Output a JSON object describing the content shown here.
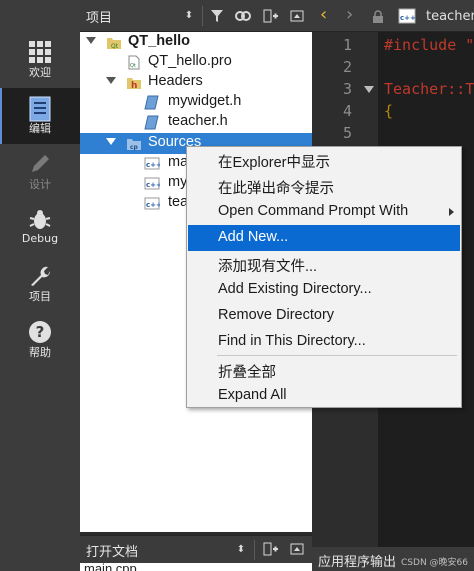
{
  "modes": [
    {
      "id": "welcome",
      "label": "欢迎",
      "icon": "grid-icon"
    },
    {
      "id": "edit",
      "label": "编辑",
      "icon": "document-icon"
    },
    {
      "id": "design",
      "label": "设计",
      "icon": "pencil-icon"
    },
    {
      "id": "debug",
      "label": "Debug",
      "icon": "bug-icon"
    },
    {
      "id": "projects",
      "label": "项目",
      "icon": "wrench-icon"
    },
    {
      "id": "help",
      "label": "帮助",
      "icon": "question-icon"
    }
  ],
  "project_panel": {
    "title": "项目",
    "tree": [
      {
        "label": "QT_hello",
        "icon": "project-folder-icon"
      },
      {
        "label": "QT_hello.pro",
        "icon": "pro-file-icon"
      },
      {
        "label": "Headers",
        "icon": "headers-folder-icon"
      },
      {
        "label": "mywidget.h",
        "icon": "header-file-icon"
      },
      {
        "label": "teacher.h",
        "icon": "header-file-icon"
      },
      {
        "label": "Sources",
        "icon": "sources-folder-icon",
        "selected": true
      },
      {
        "label": "ma",
        "icon": "cpp-file-icon"
      },
      {
        "label": "my",
        "icon": "cpp-file-icon"
      },
      {
        "label": "tea",
        "icon": "cpp-file-icon"
      }
    ]
  },
  "open_docs": {
    "title": "打开文档",
    "items": [
      "main.cpp"
    ]
  },
  "editor": {
    "tab_label": "teacher",
    "line_numbers": [
      "1",
      "2",
      "3",
      "4",
      "5"
    ],
    "code_lines": [
      "#include \"",
      "",
      "Teacher::T",
      "{",
      ""
    ]
  },
  "output": {
    "label": "应用程序输出",
    "watermark": "CSDN @晚安66"
  },
  "context_menu": {
    "items": [
      {
        "label": "在Explorer中显示"
      },
      {
        "label": "在此弹出命令提示"
      },
      {
        "label": "Open Command Prompt With",
        "submenu": true
      },
      {
        "label": "Add New...",
        "highlighted": true
      },
      {
        "label": "添加现有文件..."
      },
      {
        "label": "Add Existing Directory..."
      },
      {
        "label": "Remove Directory"
      },
      {
        "label": "Find in This Directory..."
      },
      {
        "label": "折叠全部"
      },
      {
        "label": "Expand All"
      }
    ]
  },
  "colors": {
    "selection": "#2f7fd3",
    "menu_highlight": "#0a6ad1",
    "keyword": "#c0392b",
    "brace": "#b8860b"
  }
}
